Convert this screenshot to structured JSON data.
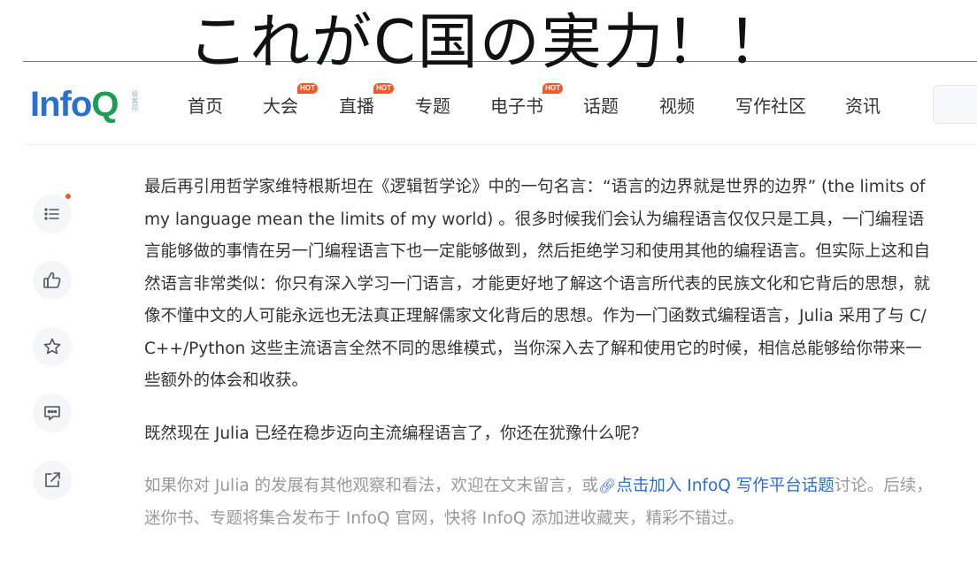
{
  "caption": "これがC国の実力！！",
  "logo": {
    "info": "Info",
    "q": "Q",
    "sub": "极客邦"
  },
  "nav": {
    "items": [
      {
        "label": "首页",
        "hot": ""
      },
      {
        "label": "大会",
        "hot": "HOT"
      },
      {
        "label": "直播",
        "hot": "HOT"
      },
      {
        "label": "专题",
        "hot": ""
      },
      {
        "label": "电子书",
        "hot": "HOT"
      },
      {
        "label": "话题",
        "hot": ""
      },
      {
        "label": "视频",
        "hot": ""
      },
      {
        "label": "写作社区",
        "hot": ""
      },
      {
        "label": "资讯",
        "hot": ""
      }
    ]
  },
  "sidebar": {
    "buttons": [
      "menu-icon",
      "thumbs-up-icon",
      "star-icon",
      "comment-icon",
      "share-icon"
    ],
    "accent": "#f25a29"
  },
  "article": {
    "p1": "最后再引用哲学家维特根斯坦在《逻辑哲学论》中的一句名言：“语言的边界就是世界的边界” (the limits of my language mean the limits of my world) 。很多时候我们会认为编程语言仅仅只是工具，一门编程语言能够做的事情在另一门编程语言下也一定能够做到，然后拒绝学习和使用其他的编程语言。但实际上这和自然语言非常类似：你只有深入学习一门语言，才能更好地了解这个语言所代表的民族文化和它背后的思想，就像不懂中文的人可能永远也无法真正理解儒家文化背后的思想。作为一门函数式编程语言，Julia 采用了与 C/C++/Python 这些主流语言全然不同的思维模式，当你深入去了解和使用它的时候，相信总能够给你带来一些额外的体会和收获。",
    "p2": "既然现在 Julia 已经在稳步迈向主流编程语言了，你还在犹豫什么呢?",
    "p3_before": "如果你对 Julia 的发展有其他观察和看法，欢迎在文末留言，或",
    "p3_link": "点击加入 InfoQ 写作平台话题",
    "p3_after": "讨论。后续，迷你书、专题将集合发布于 InfoQ 官网，快将 InfoQ 添加进收藏夹，精彩不错过。"
  },
  "colors": {
    "brand_blue": "#2a6fd1",
    "brand_green": "#1c9e53",
    "hot": "#f25a29"
  }
}
